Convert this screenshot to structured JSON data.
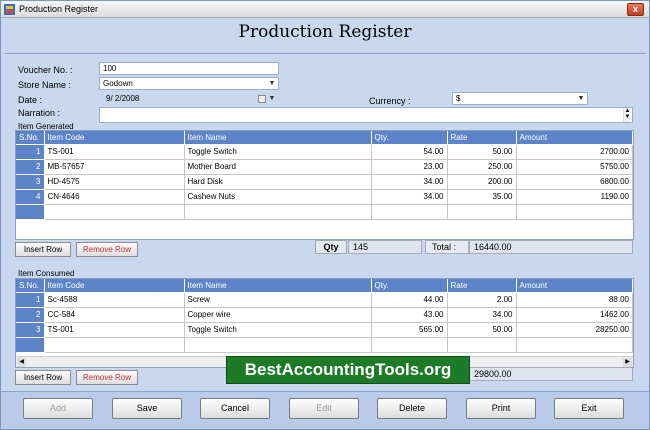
{
  "window": {
    "title": "Production Register",
    "close_label": "x"
  },
  "heading": "Production Register",
  "form": {
    "voucher_label": "Voucher No. :",
    "voucher_value": "100",
    "store_label": "Store Name :",
    "store_value": "Godown",
    "date_label": "Date :",
    "date_value": "9/ 2/2008",
    "narration_label": "Narration :",
    "narration_value": "",
    "currency_label": "Currency :",
    "currency_value": "$"
  },
  "generated": {
    "group_label": "Item Generated",
    "columns": [
      "S.No.",
      "Item Code",
      "Item Name",
      "Qty.",
      "Rate",
      "Amount"
    ],
    "rows": [
      {
        "sn": "1",
        "code": "TS-001",
        "name": "Toggle Switch",
        "qty": "54.00",
        "rate": "50.00",
        "amount": "2700.00"
      },
      {
        "sn": "2",
        "code": "MB-57657",
        "name": "Mother Board",
        "qty": "23.00",
        "rate": "250.00",
        "amount": "5750.00"
      },
      {
        "sn": "3",
        "code": "HD-4575",
        "name": "Hard Disk",
        "qty": "34.00",
        "rate": "200.00",
        "amount": "6800.00"
      },
      {
        "sn": "4",
        "code": "CN-4646",
        "name": "Cashew Nuts",
        "qty": "34.00",
        "rate": "35.00",
        "amount": "1190.00"
      }
    ],
    "insert_label": "Insert Row",
    "remove_label": "Remove Row",
    "qty_label": "Qty",
    "qty_value": "145",
    "total_label": "Total :",
    "total_value": "16440.00"
  },
  "consumed": {
    "group_label": "Item Consumed",
    "columns": [
      "S.No.",
      "Item Code",
      "Item Name",
      "Qty.",
      "Rate",
      "Amount"
    ],
    "rows": [
      {
        "sn": "1",
        "code": "Sc-4588",
        "name": "Screw",
        "qty": "44.00",
        "rate": "2.00",
        "amount": "88.00"
      },
      {
        "sn": "2",
        "code": "CC-584",
        "name": "Copper wire",
        "qty": "43.00",
        "rate": "34.00",
        "amount": "1462.00"
      },
      {
        "sn": "3",
        "code": "TS-001",
        "name": "Toggle Switch",
        "qty": "565.00",
        "rate": "50.00",
        "amount": "28250.00"
      }
    ],
    "insert_label": "Insert Row",
    "remove_label": "Remove Row",
    "total_value": "29800.00"
  },
  "banner": "BestAccountingTools.org",
  "buttons": {
    "add": "Add",
    "save": "Save",
    "cancel": "Cancel",
    "edit": "Edit",
    "delete": "Delete",
    "print": "Print",
    "exit": "Exit"
  }
}
